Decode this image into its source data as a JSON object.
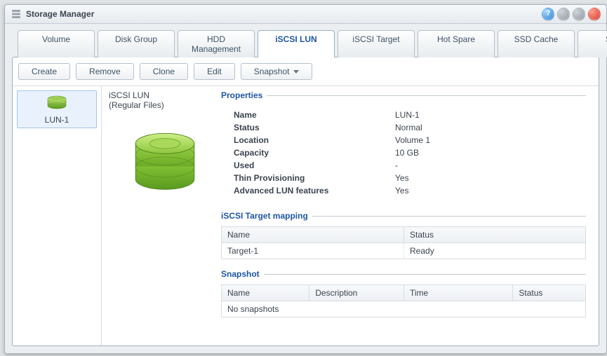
{
  "window": {
    "title": "Storage Manager"
  },
  "tabs": {
    "items": [
      {
        "label": "Volume"
      },
      {
        "label": "Disk Group"
      },
      {
        "label": "HDD Management"
      },
      {
        "label": "iSCSI LUN"
      },
      {
        "label": "iSCSI Target"
      },
      {
        "label": "Hot Spare"
      },
      {
        "label": "SSD Cache"
      },
      {
        "label": "Swap"
      }
    ],
    "active_index": 3
  },
  "toolbar": {
    "create": "Create",
    "remove": "Remove",
    "clone": "Clone",
    "edit": "Edit",
    "snapshot": "Snapshot"
  },
  "sidebar": {
    "items": [
      {
        "label": "LUN-1"
      }
    ],
    "selected_index": 0
  },
  "detail": {
    "heading": "iSCSI LUN",
    "subheading": "(Regular Files)",
    "properties": {
      "legend": "Properties",
      "rows": [
        {
          "k": "Name",
          "v": "LUN-1"
        },
        {
          "k": "Status",
          "v": "Normal",
          "green": true
        },
        {
          "k": "Location",
          "v": "Volume 1"
        },
        {
          "k": "Capacity",
          "v": "10 GB"
        },
        {
          "k": "Used",
          "v": "-"
        },
        {
          "k": "Thin Provisioning",
          "v": "Yes"
        },
        {
          "k": "Advanced LUN features",
          "v": "Yes"
        }
      ]
    },
    "mapping": {
      "legend": "iSCSI Target mapping",
      "columns": [
        "Name",
        "Status"
      ],
      "rows": [
        {
          "name": "Target-1",
          "status": "Ready",
          "status_green": true
        }
      ]
    },
    "snapshot": {
      "legend": "Snapshot",
      "columns": [
        "Name",
        "Description",
        "Time",
        "Status"
      ],
      "empty_text": "No snapshots",
      "rows": []
    }
  }
}
